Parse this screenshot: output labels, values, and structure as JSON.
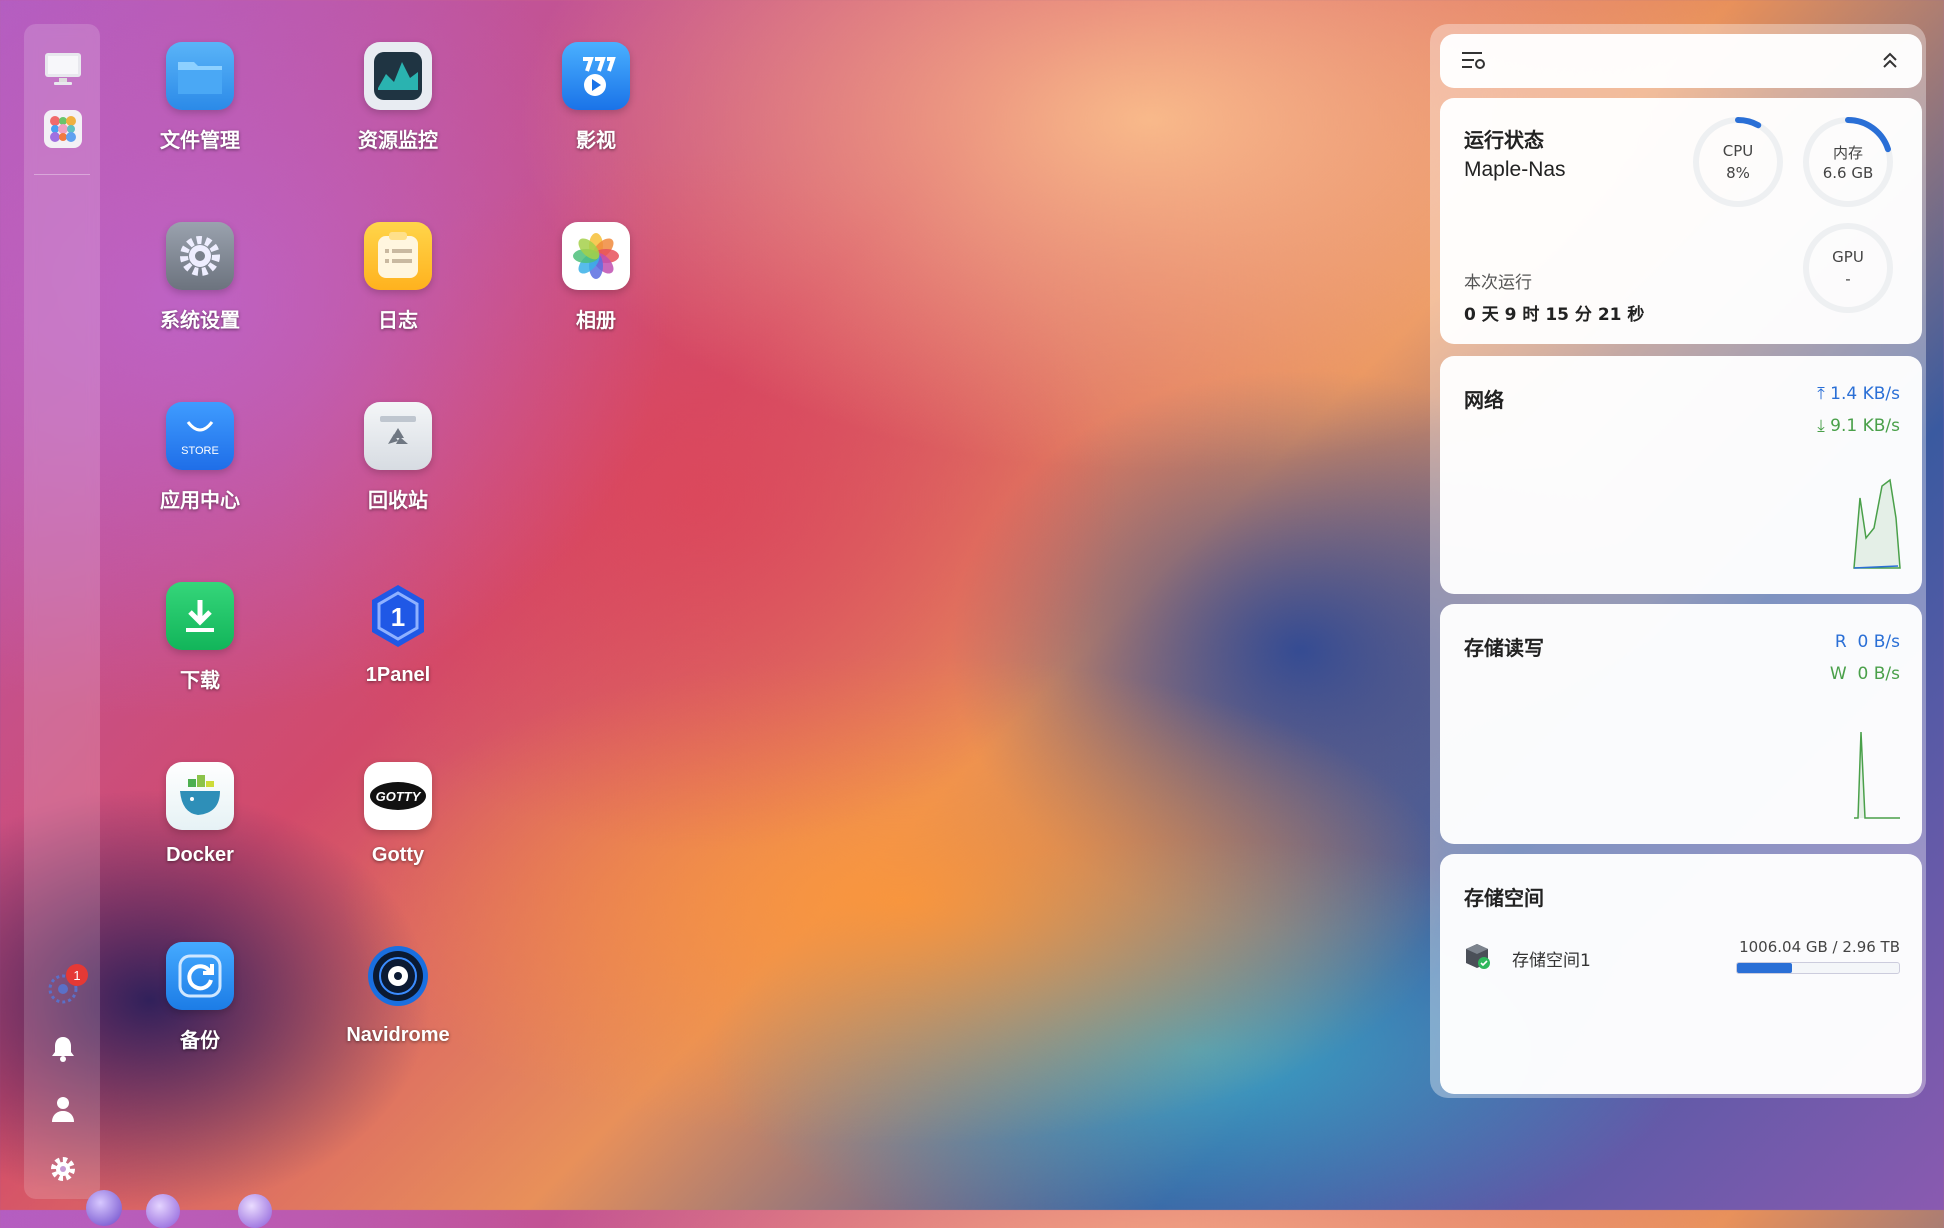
{
  "dock": {
    "top_icons": [
      "monitor-icon",
      "app-grid-icon"
    ],
    "bottom_icons": [
      "sparkle-icon",
      "bell-icon",
      "user-icon",
      "gear-icon"
    ],
    "notification_count": "1"
  },
  "apps": [
    {
      "label": "文件管理",
      "icon": "folder-icon"
    },
    {
      "label": "资源监控",
      "icon": "monitor-chart-icon"
    },
    {
      "label": "影视",
      "icon": "video-icon"
    },
    {
      "label": "系统设置",
      "icon": "settings-icon"
    },
    {
      "label": "日志",
      "icon": "log-icon"
    },
    {
      "label": "相册",
      "icon": "photos-icon"
    },
    {
      "label": "应用中心",
      "icon": "store-icon"
    },
    {
      "label": "回收站",
      "icon": "recycle-bin-icon"
    },
    {
      "label": "下载",
      "icon": "download-icon"
    },
    {
      "label": "1Panel",
      "icon": "onepanel-icon"
    },
    {
      "label": "Docker",
      "icon": "docker-icon"
    },
    {
      "label": "Gotty",
      "icon": "gotty-icon"
    },
    {
      "label": "备份",
      "icon": "backup-icon"
    },
    {
      "label": "Navidrome",
      "icon": "navidrome-icon"
    }
  ],
  "store_text": "STORE",
  "gotty_text": "GOTTY",
  "status": {
    "title": "运行状态",
    "hostname": "Maple-Nas",
    "cpu_label": "CPU",
    "cpu_value": "8%",
    "cpu_fraction": 0.08,
    "mem_label": "内存",
    "mem_value": "6.6 GB",
    "mem_fraction": 0.2,
    "gpu_label": "GPU",
    "gpu_value": "-",
    "uptime_label": "本次运行",
    "uptime": "0 天 9 时 15 分 21 秒"
  },
  "network": {
    "title": "网络",
    "upload": "1.4 KB/s",
    "download": "9.1 KB/s"
  },
  "disk_io": {
    "title": "存储读写",
    "read_label": "R",
    "read": "0 B/s",
    "write_label": "W",
    "write": "0 B/s"
  },
  "storage": {
    "title": "存储空间",
    "name": "存储空间1",
    "usage": "1006.04 GB / 2.96 TB",
    "fraction": 0.34
  },
  "colors": {
    "accent": "#2a6fd6",
    "green": "#4aa04a"
  }
}
